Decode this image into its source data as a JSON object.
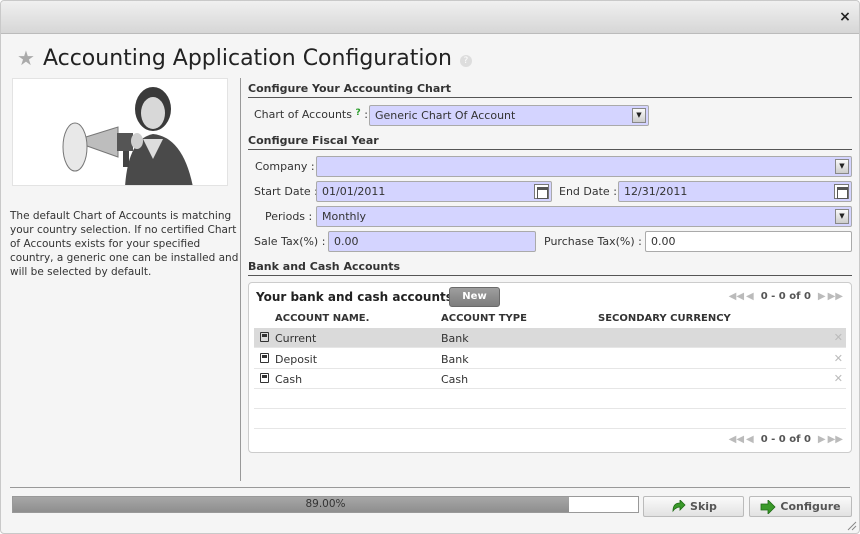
{
  "window": {
    "close_glyph": "×"
  },
  "header": {
    "title": "Accounting Application Configuration",
    "help": "?"
  },
  "left": {
    "help_text": "The default Chart of Accounts is matching your country selection. If no certified Chart of Accounts exists for your specified country, a generic one can be installed and will be selected by default."
  },
  "chart_section": {
    "title": "Configure Your Accounting Chart",
    "chart_label": "Chart of Accounts",
    "chart_help": "?",
    "chart_colon": ":",
    "chart_value": "Generic Chart Of Account"
  },
  "fiscal_section": {
    "title": "Configure Fiscal Year",
    "company_label": "Company :",
    "company_value": "",
    "start_label": "Start Date :",
    "start_value": "01/01/2011",
    "end_label": "End Date :",
    "end_value": "12/31/2011",
    "periods_label": "Periods :",
    "periods_value": "Monthly",
    "sale_tax_label": "Sale Tax(%) :",
    "sale_tax_value": "0.00",
    "purchase_tax_label": "Purchase Tax(%) :",
    "purchase_tax_value": "0.00"
  },
  "bank_section": {
    "title": "Bank and Cash Accounts",
    "panel_title": "Your bank and cash accounts",
    "new_label": "New",
    "pager_text": "0 - 0 of 0",
    "columns": [
      "ACCOUNT NAME.",
      "ACCOUNT TYPE",
      "SECONDARY CURRENCY"
    ],
    "rows": [
      {
        "name": "Current",
        "type": "Bank",
        "currency": ""
      },
      {
        "name": "Deposit",
        "type": "Bank",
        "currency": ""
      },
      {
        "name": "Cash",
        "type": "Cash",
        "currency": ""
      }
    ]
  },
  "footer": {
    "progress_text": "89.00%",
    "progress_value": 0.89,
    "skip_label": "Skip",
    "configure_label": "Configure"
  },
  "colors": {
    "required_field": "#d4d4ff",
    "accent_green": "#3a9a2a"
  }
}
